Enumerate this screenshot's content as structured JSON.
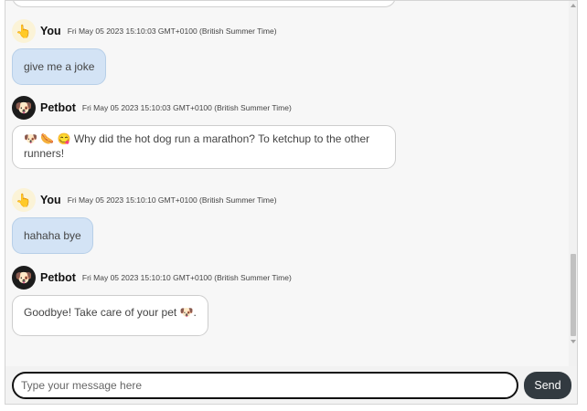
{
  "messages": [
    {
      "sender": "You",
      "role": "user",
      "avatar_icon": "👆",
      "timestamp": "Fri May 05 2023 15:10:03 GMT+0100 (British Summer Time)",
      "text": "give me a joke"
    },
    {
      "sender": "Petbot",
      "role": "bot",
      "avatar_icon": "🐶",
      "timestamp": "Fri May 05 2023 15:10:03 GMT+0100 (British Summer Time)",
      "text_line1": "🐶 🌭 😋  Why did the hot dog run a marathon? To ketchup to the other",
      "text_line2": "runners!"
    },
    {
      "sender": "You",
      "role": "user",
      "avatar_icon": "👆",
      "timestamp": "Fri May 05 2023 15:10:10 GMT+0100 (British Summer Time)",
      "text": "hahaha bye"
    },
    {
      "sender": "Petbot",
      "role": "bot",
      "avatar_icon": "🐶",
      "timestamp": "Fri May 05 2023 15:10:10 GMT+0100 (British Summer Time)",
      "text": "Goodbye! Take care of your pet 🐶."
    }
  ],
  "input": {
    "placeholder": "Type your message here",
    "value": ""
  },
  "send_label": "Send"
}
